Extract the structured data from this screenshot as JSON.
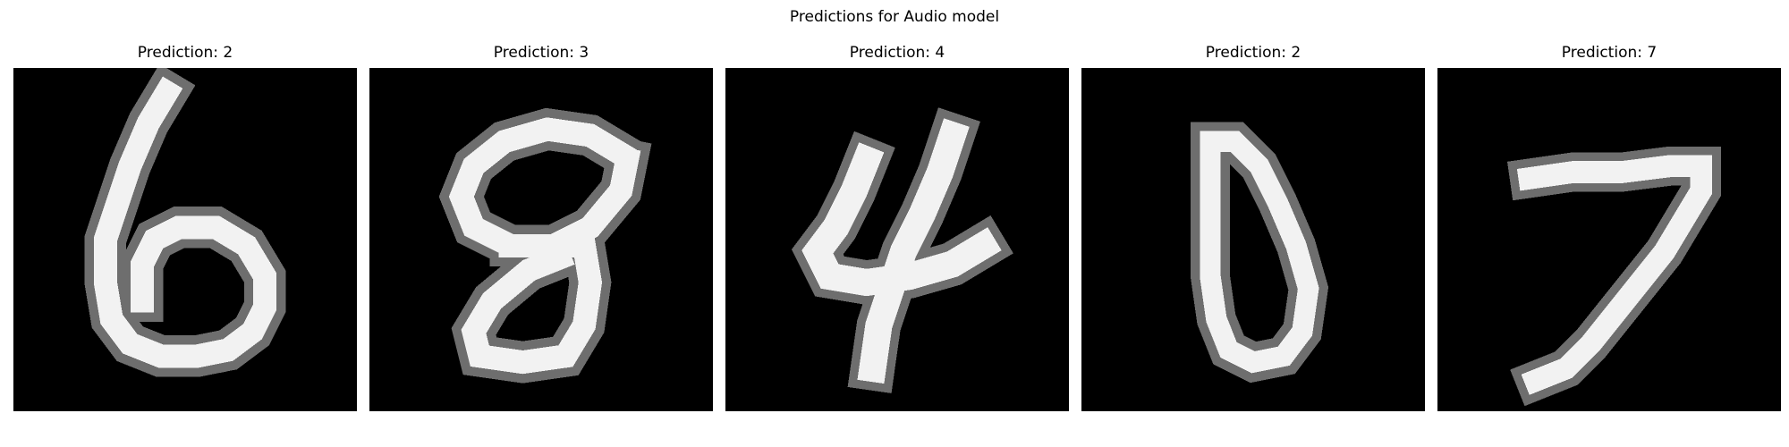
{
  "figure": {
    "title": "Predictions for Audio model"
  },
  "panels": [
    {
      "title": "Prediction: 2",
      "image": "handwritten-digit-6",
      "digit_shown": "6"
    },
    {
      "title": "Prediction: 3",
      "image": "handwritten-digit-8",
      "digit_shown": "8"
    },
    {
      "title": "Prediction: 4",
      "image": "handwritten-digit-4",
      "digit_shown": "4"
    },
    {
      "title": "Prediction: 2",
      "image": "handwritten-digit-0",
      "digit_shown": "0"
    },
    {
      "title": "Prediction: 7",
      "image": "handwritten-digit-7",
      "digit_shown": "7"
    }
  ],
  "colors": {
    "background": "#ffffff",
    "image_background": "#000000",
    "stroke": "#f2f2f2"
  }
}
